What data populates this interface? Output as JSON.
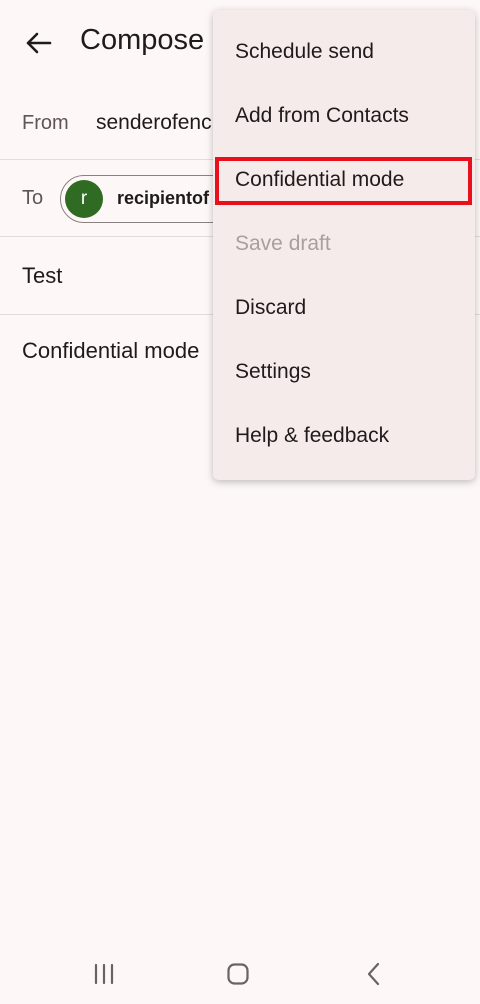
{
  "appbar": {
    "title": "Compose",
    "back_icon": "arrow-left-icon"
  },
  "from": {
    "label": "From",
    "value": "senderofenc"
  },
  "to": {
    "label": "To",
    "recipient_initial": "r",
    "recipient": "recipientof",
    "avatar_color": "#2f6b22"
  },
  "subject": {
    "value": "Test"
  },
  "body": {
    "value": "Confidential mode"
  },
  "menu": {
    "items": [
      {
        "label": "Schedule send",
        "enabled": true
      },
      {
        "label": "Add from Contacts",
        "enabled": true
      },
      {
        "label": "Confidential mode",
        "enabled": true,
        "highlighted": true
      },
      {
        "label": "Save draft",
        "enabled": false
      },
      {
        "label": "Discard",
        "enabled": true
      },
      {
        "label": "Settings",
        "enabled": true
      },
      {
        "label": "Help & feedback",
        "enabled": true
      }
    ],
    "highlight_color": "#e8101a"
  },
  "navbar": {
    "icons": [
      "recents-icon",
      "home-icon",
      "back-icon"
    ]
  }
}
